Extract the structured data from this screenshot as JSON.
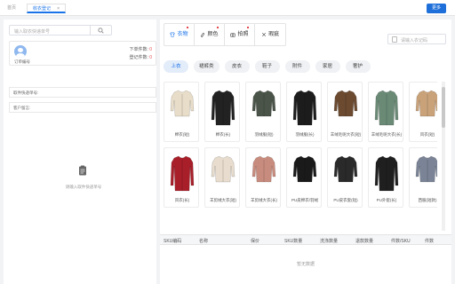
{
  "topbar": {
    "home_tab": "首页",
    "active_tab": "收衣登记",
    "close_symbol": "×",
    "more_button": "更多"
  },
  "left": {
    "search_placeholder": "输入取衣快递单号",
    "customer_label": "订单编号",
    "stats": [
      {
        "label": "下单件数:",
        "value": "0"
      },
      {
        "label": "登记件数:",
        "value": "0"
      }
    ],
    "field_1": "取件快递单号:",
    "field_2": "客户留言:",
    "empty_tip": "请输入取件快递单号"
  },
  "right": {
    "categories": [
      {
        "label": "衣物",
        "icon": "shirt-icon",
        "active": true
      },
      {
        "label": "颜色",
        "icon": "palette-icon",
        "active": false
      },
      {
        "label": "拍照",
        "icon": "camera-icon",
        "active": false
      },
      {
        "label": "瑕疵",
        "icon": "tools-icon",
        "active": false
      }
    ],
    "code_placeholder": "请输入衣记码",
    "subtabs": [
      "上衣",
      "裙裤类",
      "皮衣",
      "鞋子",
      "附件",
      "家居",
      "奢护"
    ],
    "items": [
      {
        "name": "棉衣(短)",
        "color": "#e8ddc8",
        "style": "short"
      },
      {
        "name": "棉衣(长)",
        "color": "#222222",
        "style": "long"
      },
      {
        "name": "羽绒服(短)",
        "color": "#4a5448",
        "style": "short"
      },
      {
        "name": "羽绒服(长)",
        "color": "#1c1c1c",
        "style": "long"
      },
      {
        "name": "羊绒毛呢大衣(短)",
        "color": "#6b4a30",
        "style": "short"
      },
      {
        "name": "羊绒毛呢大衣(长)",
        "color": "#6a8a76",
        "style": "long"
      },
      {
        "name": "风衣(短)",
        "color": "#c9a27a",
        "style": "short"
      },
      {
        "name": "风衣(长)",
        "color": "#a81f2a",
        "style": "long"
      },
      {
        "name": "羊剪绒大衣(短)",
        "color": "#e7dccd",
        "style": "short"
      },
      {
        "name": "羊剪绒大衣(长)",
        "color": "#c88c7e",
        "style": "short"
      },
      {
        "name": "PU皮棉衣/羽绒",
        "color": "#1a1a1a",
        "style": "short"
      },
      {
        "name": "PU皮衣套(短)",
        "color": "#2a2a2a",
        "style": "short"
      },
      {
        "name": "PU外套(长)",
        "color": "#1f1f1f",
        "style": "long"
      },
      {
        "name": "西服(短款)",
        "color": "#7a8496",
        "style": "short"
      }
    ],
    "table_headers": [
      "SKU编码",
      "名称",
      "保价",
      "SKU数量",
      "洗涤数量",
      "退款数量",
      "件数/SKU",
      "件数"
    ],
    "no_data": "暂无数据"
  }
}
